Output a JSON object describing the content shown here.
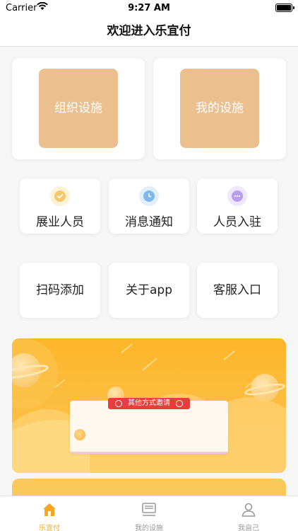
{
  "status_bar": {
    "carrier": "Carrier",
    "time": "9:27 AM"
  },
  "nav": {
    "title": "欢迎进入乐宜付"
  },
  "big_cards": [
    {
      "label": "组织设施"
    },
    {
      "label": "我的设施"
    }
  ],
  "icon_cards": [
    {
      "label": "展业人员",
      "icon": "check-badge-icon",
      "color": "#f5c96a",
      "bg": "#fdf1d8"
    },
    {
      "label": "消息通知",
      "icon": "clock-icon",
      "color": "#7fb8ee",
      "bg": "#e2effb"
    },
    {
      "label": "人员入驻",
      "icon": "chat-dots-icon",
      "color": "#b79cf0",
      "bg": "#efe7fc"
    }
  ],
  "plain_cards": [
    {
      "label": "扫码添加"
    },
    {
      "label": "关于app"
    },
    {
      "label": "客服入口"
    }
  ],
  "banner": {
    "ribbon_label": "其他方式邀请",
    "accent": "#fbb733",
    "ribbon_color": "#e93d3d"
  },
  "tab_bar": {
    "items": [
      {
        "label": "乐宜付",
        "icon": "home-icon",
        "active": true
      },
      {
        "label": "我的设施",
        "icon": "device-icon",
        "active": false
      },
      {
        "label": "我自己",
        "icon": "person-icon",
        "active": false
      }
    ],
    "active_color": "#f5a623",
    "inactive_color": "#999999"
  }
}
